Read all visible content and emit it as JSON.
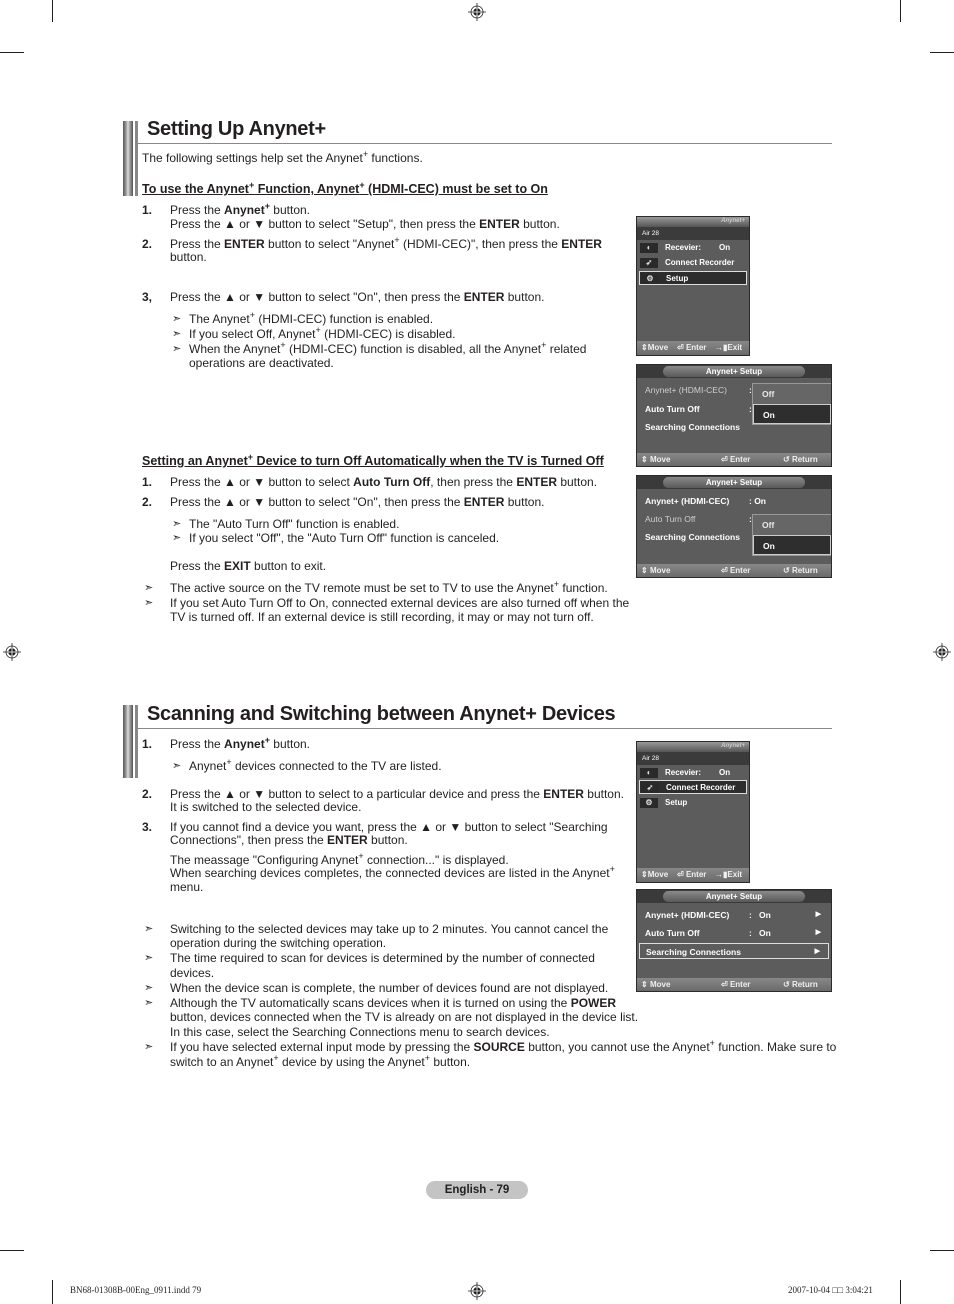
{
  "section1": {
    "title": "Setting Up Anynet+",
    "intro_pre": "The following settings help set the Anynet",
    "intro_post": " functions.",
    "sub1": {
      "heading_a": "To use the Anynet",
      "heading_b": " Function, Anynet",
      "heading_c": " (HDMI-CEC) must be set to On",
      "steps": [
        {
          "num": "1.",
          "l1a": "Press the ",
          "l1b": "Anynet",
          "l1c": " button.",
          "l2a": "Press the ▲ or ▼ button to select \"Setup\", then press the ",
          "l2b": "ENTER",
          "l2c": " button."
        },
        {
          "num": "2.",
          "l1a": "Press the ",
          "l1b": "ENTER",
          "l1c": " button to select \"Anynet",
          "l1d": " (HDMI-CEC)\", then press the ",
          "l1e": "ENTER",
          "l2": "button."
        },
        {
          "num": "3,",
          "l1a": "Press the ▲ or ▼ button to select \"On\", then press the ",
          "l1b": "ENTER",
          "l1c": " button."
        }
      ],
      "notes": [
        {
          "a": "The Anynet",
          "b": " (HDMI-CEC) function is enabled."
        },
        {
          "a": "If you select Off, Anynet",
          "b": " (HDMI-CEC) is disabled."
        },
        {
          "a": "When the Anynet",
          "b": " (HDMI-CEC) function is disabled, all the Anynet",
          "c": " related",
          "d": "operations are deactivated."
        }
      ]
    },
    "sub2": {
      "heading_a": "Setting an Anynet",
      "heading_b": " Device to turn Off Automatically when the TV is Turned Off",
      "steps": [
        {
          "num": "1.",
          "a": "Press the ▲ or ▼ button to select ",
          "b": "Auto Turn Off",
          "c": ", then press the ",
          "d": "ENTER",
          "e": " button."
        },
        {
          "num": "2.",
          "a": "Press the ▲ or ▼ button to select \"On\", then press the ",
          "b": "ENTER",
          "c": " button."
        }
      ],
      "notes": [
        "The \"Auto Turn Off\" function is enabled.",
        "If you select \"Off\", the \"Auto Turn Off\" function is canceled."
      ],
      "exit_a": "Press the ",
      "exit_b": "EXIT",
      "exit_c": " button to exit.",
      "tips": [
        {
          "a": "The active source on the TV remote must be set to TV to use the Anynet",
          "b": " function."
        },
        {
          "a": "If you set Auto Turn Off to On, connected external devices are also turned off when the",
          "b": "TV is turned off. If an external device is still recording, it may or may not turn off."
        }
      ]
    }
  },
  "section2": {
    "title": "Scanning and Switching between Anynet+ Devices",
    "steps": [
      {
        "num": "1.",
        "a": "Press the ",
        "b": "Anynet",
        "c": " button.",
        "note_a": "Anynet",
        "note_b": " devices connected to the TV are listed."
      },
      {
        "num": "2.",
        "a": "Press the ▲ or ▼ button to select to a particular device and press the ",
        "b": "ENTER",
        "c": " button.",
        "l2": "It is switched to the selected device."
      },
      {
        "num": "3.",
        "a": "If you cannot find a device you want, press the ▲ or ▼ button to select \"Searching",
        "l2a": "Connections\", then press the ",
        "l2b": "ENTER",
        "l2c": " button.",
        "l3a": "The meassage \"Configuring Anynet",
        "l3b": " connection...\" is displayed.",
        "l4a": "When searching devices completes, the connected devices are listed in the Anynet",
        "l5": "menu."
      }
    ],
    "tips": [
      {
        "l1": "Switching to the selected devices may take up to 2 minutes. You cannot cancel the",
        "l2": "operation during the switching operation."
      },
      {
        "l1": "The time required to scan for devices is determined by the number of connected",
        "l2": "devices."
      },
      {
        "l1": "When the device scan is complete, the number of devices found are not displayed."
      },
      {
        "l1a": "Although the TV automatically scans devices when it is turned on using the ",
        "l1b": "POWER",
        "l2": "button, devices connected when the TV is already on are not displayed in the device list.",
        "l3": "In this case, select the Searching Connections menu to search devices."
      },
      {
        "l1a": "If you have selected external input mode by pressing the ",
        "l1b": "SOURCE",
        "l1c": " button, you cannot use the Anynet",
        "l1d": " function. Make sure to",
        "l2a": "switch to an Anynet",
        "l2b": " device by using the Anynet",
        "l2c": " button."
      }
    ]
  },
  "sup_plus": "+",
  "tip_arrow": "➣",
  "tv_menu_1": {
    "logo": "Anynet+",
    "channel": "Air 28",
    "items": [
      {
        "icon": "receiver-icon",
        "label": "Recevier:",
        "value": "On"
      },
      {
        "icon": "recorder-icon",
        "label": "Connect Recorder",
        "value": ""
      },
      {
        "icon": "setup-gear-icon",
        "label": "Setup",
        "value": ""
      }
    ],
    "selected_index": 2,
    "footer": {
      "move": "Move",
      "enter": "Enter",
      "exit": "Exit"
    }
  },
  "tv_menu_2": {
    "logo": "Anynet+",
    "channel": "Air 28",
    "items": [
      {
        "icon": "receiver-icon",
        "label": "Recevier:",
        "value": "On"
      },
      {
        "icon": "recorder-icon",
        "label": "Connect Recorder",
        "value": ""
      },
      {
        "icon": "setup-gear-icon",
        "label": "Setup",
        "value": ""
      }
    ],
    "selected_index": 1,
    "footer": {
      "move": "Move",
      "enter": "Enter",
      "exit": "Exit"
    }
  },
  "setup_screen_1": {
    "title": "Anynet+ Setup",
    "rows": [
      {
        "label": "Anynet+ (HDMI-CEC)",
        "colon": ":"
      },
      {
        "label": "Auto Turn Off",
        "colon": ":"
      },
      {
        "label": "Searching Connections"
      }
    ],
    "popup": [
      "Off",
      "On"
    ],
    "popup_selected": "On",
    "footer": {
      "move": "Move",
      "enter": "Enter",
      "return": "Return"
    }
  },
  "setup_screen_2": {
    "title": "Anynet+ Setup",
    "rows": [
      {
        "label": "Anynet+ (HDMI-CEC)",
        "value": ": On"
      },
      {
        "label": "Auto Turn Off",
        "colon": ":"
      },
      {
        "label": "Searching Connections"
      }
    ],
    "popup": [
      "Off",
      "On"
    ],
    "popup_selected": "On",
    "footer": {
      "move": "Move",
      "enter": "Enter",
      "return": "Return"
    }
  },
  "setup_screen_3": {
    "title": "Anynet+ Setup",
    "rows": [
      {
        "label": "Anynet+ (HDMI-CEC)",
        "colon": ":",
        "value": "On",
        "arrow": "▶"
      },
      {
        "label": "Auto Turn Off",
        "colon": ":",
        "value": "On",
        "arrow": "▶"
      },
      {
        "label": "Searching Connections",
        "arrow": "▶"
      }
    ],
    "selected_index": 2,
    "footer": {
      "move": "Move",
      "enter": "Enter",
      "return": "Return"
    }
  },
  "page_badge": "English - 79",
  "slug": {
    "file": "BN68-01308B-00Eng_0911.indd   79",
    "date": "2007-10-04   □□ 3:04:21"
  }
}
